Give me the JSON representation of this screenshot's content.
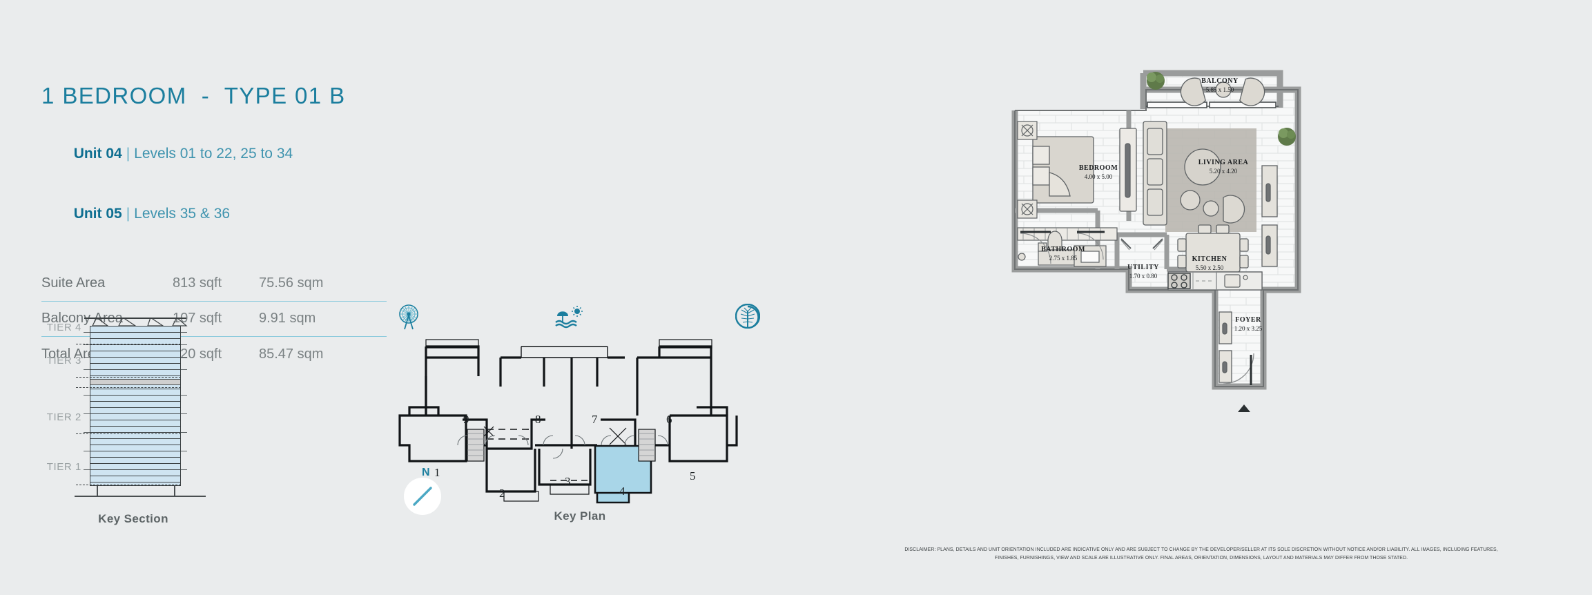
{
  "header": {
    "title": "1 BEDROOM  -  TYPE 01 B",
    "units": [
      {
        "name": "Unit 04",
        "separator": "|",
        "levels": "Levels 01 to 22, 25 to 34"
      },
      {
        "name": "Unit 05",
        "separator": "|",
        "levels": "Levels 35 & 36"
      }
    ]
  },
  "area_table": {
    "rows": [
      {
        "label": "Suite Area",
        "sqft": "813 sqft",
        "sqm": "75.56 sqm"
      },
      {
        "label": "Balcony Area",
        "sqft": "107 sqft",
        "sqm": "9.91 sqm"
      },
      {
        "label": "Total Area",
        "sqft": "920 sqft",
        "sqm": "85.47 sqm"
      }
    ]
  },
  "key_section": {
    "caption": "Key Section",
    "tiers": [
      {
        "label": "TIER 4"
      },
      {
        "label": "TIER 3"
      },
      {
        "label": "TIER 2"
      },
      {
        "label": "TIER 1"
      }
    ]
  },
  "key_plan": {
    "caption": "Key Plan",
    "compass_label": "N",
    "icons": [
      {
        "name": "ain-dubai-icon",
        "label": "Ain Dubai"
      },
      {
        "name": "beach-icon",
        "label": "Beach"
      },
      {
        "name": "palm-jumeirah-icon",
        "label": "Palm Jumeirah"
      }
    ],
    "units": [
      {
        "number": "9",
        "highlighted": false
      },
      {
        "number": "8",
        "highlighted": false
      },
      {
        "number": "7",
        "highlighted": false
      },
      {
        "number": "6",
        "highlighted": false
      },
      {
        "number": "1",
        "highlighted": false
      },
      {
        "number": "2",
        "highlighted": false
      },
      {
        "number": "3",
        "highlighted": false
      },
      {
        "number": "4",
        "highlighted": true
      },
      {
        "number": "5",
        "highlighted": false
      }
    ],
    "highlight_color": "#a9d6e8"
  },
  "floor_plan": {
    "rooms": [
      {
        "name": "BALCONY",
        "dims": "5.85 x 1.50"
      },
      {
        "name": "LIVING AREA",
        "dims": "5.20 x 4.20"
      },
      {
        "name": "BEDROOM",
        "dims": "4.00 x 5.00"
      },
      {
        "name": "BATHROOM",
        "dims": "2.75 x 1.85"
      },
      {
        "name": "UTILITY",
        "dims": "1.70 x 0.80"
      },
      {
        "name": "KITCHEN",
        "dims": "5.50 x 2.50"
      },
      {
        "name": "FOYER",
        "dims": "1.20 x 3.25"
      }
    ]
  },
  "disclaimer": {
    "line1": "DISCLAIMER: PLANS, DETAILS AND UNIT ORIENTATION INCLUDED ARE INDICATIVE ONLY AND ARE SUBJECT TO CHANGE BY THE DEVELOPER/SELLER AT ITS SOLE DISCRETION WITHOUT NOTICE AND/OR LIABILITY. ALL IMAGES, INCLUDING FEATURES,",
    "line2": "FINISHES, FURNISHINGS, VIEW AND SCALE ARE ILLUSTRATIVE ONLY. FINAL AREAS, ORIENTATION, DIMENSIONS, LAYOUT AND MATERIALS MAY DIFFER FROM THOSE STATED."
  },
  "colors": {
    "background": "#eaeced",
    "accent_teal": "#1b7e9e",
    "rule_blue": "#8ecbdd",
    "text_gray": "#6a7173"
  }
}
